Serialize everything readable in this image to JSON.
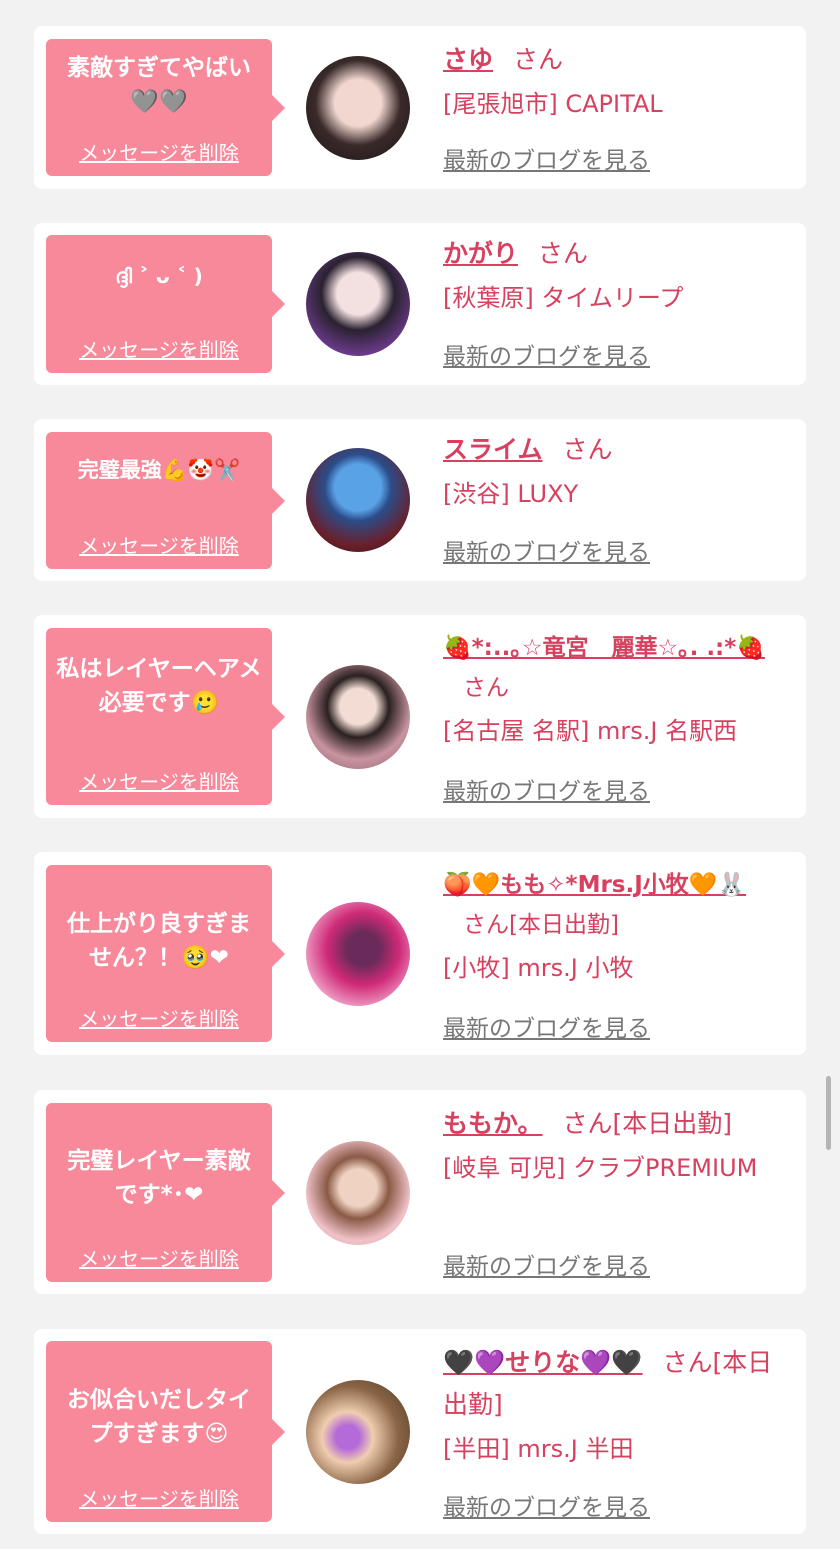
{
  "delete_label": "メッセージを削除",
  "blog_label": "最新のブログを見る",
  "san_label": "さん",
  "colors": {
    "page_bg": "#f2f2f2",
    "card_bg": "#ffffff",
    "bubble_bg": "#f7899a",
    "accent": "#d7405f",
    "link_gray": "#777777"
  },
  "items": [
    {
      "message": "素敵すぎてやばい🩶🩶",
      "name": "さゆ",
      "san_suffix": "さん",
      "shop": "[尾張旭市] CAPITAL",
      "avatar_icon": "photo-avatar-icon"
    },
    {
      "message": "ദ്ദി ˃ ᴗ ˂ )",
      "name": "かがり",
      "san_suffix": "さん",
      "shop": "[秋葉原] タイムリープ",
      "avatar_icon": "photo-avatar-icon"
    },
    {
      "message": "完璧最強💪🤡✂️",
      "name": "スライム",
      "san_suffix": "さん",
      "shop": "[渋谷] LUXY",
      "avatar_icon": "photo-avatar-icon"
    },
    {
      "message": "私はレイヤーヘアメ必要です🥲",
      "name": "🍓*:..｡☆竜宮　麗華☆｡. .:*🍓",
      "san_suffix": "さん",
      "shop": "[名古屋 名駅] mrs.J 名駅西",
      "avatar_icon": "photo-avatar-icon"
    },
    {
      "message": "仕上がり良すぎません？！🥹❤",
      "name": "🍑🧡もも✧*Mrs.J小牧🧡🐰",
      "san_suffix": "さん[本日出勤]",
      "shop": "[小牧] mrs.J 小牧",
      "avatar_icon": "photo-avatar-icon"
    },
    {
      "message": "完璧レイヤー素敵です*･❤",
      "name": "ももか。",
      "san_suffix": "さん[本日出勤]",
      "shop": "[岐阜 可児] クラブPREMIUM",
      "avatar_icon": "photo-avatar-icon"
    },
    {
      "message": "お似合いだしタイプすぎます😍",
      "name": "🖤💜せりな💜🖤",
      "san_suffix": "さん[本日出勤]",
      "shop": "[半田] mrs.J 半田",
      "avatar_icon": "photo-avatar-icon"
    }
  ]
}
